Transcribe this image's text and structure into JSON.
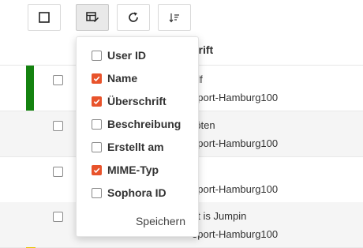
{
  "toolbar": {
    "buttons": [
      {
        "icon": "checkbox-icon"
      },
      {
        "icon": "column-settings-icon",
        "active": true
      },
      {
        "icon": "refresh-icon"
      },
      {
        "icon": "sort-icon"
      }
    ]
  },
  "table": {
    "header": {
      "label": "hrift"
    },
    "rows": [
      {
        "title": "olf",
        "subtitle": "eport-Hamburg100",
        "accent_color": "#14820f"
      },
      {
        "title": "röten",
        "subtitle": "eport-Hamburg100"
      },
      {
        "title": "",
        "subtitle": "eport-Hamburg100"
      },
      {
        "title": "nt is Jumpin",
        "subtitle": "eport-Hamburg100"
      }
    ]
  },
  "column_menu": {
    "items": [
      {
        "label": "User ID",
        "checked": false
      },
      {
        "label": "Name",
        "checked": true
      },
      {
        "label": "Überschrift",
        "checked": true
      },
      {
        "label": "Beschreibung",
        "checked": false
      },
      {
        "label": "Erstellt am",
        "checked": false
      },
      {
        "label": "MIME-Typ",
        "checked": true
      },
      {
        "label": "Sophora ID",
        "checked": false
      }
    ],
    "save_label": "Speichern",
    "check_color": "#e8532b"
  }
}
